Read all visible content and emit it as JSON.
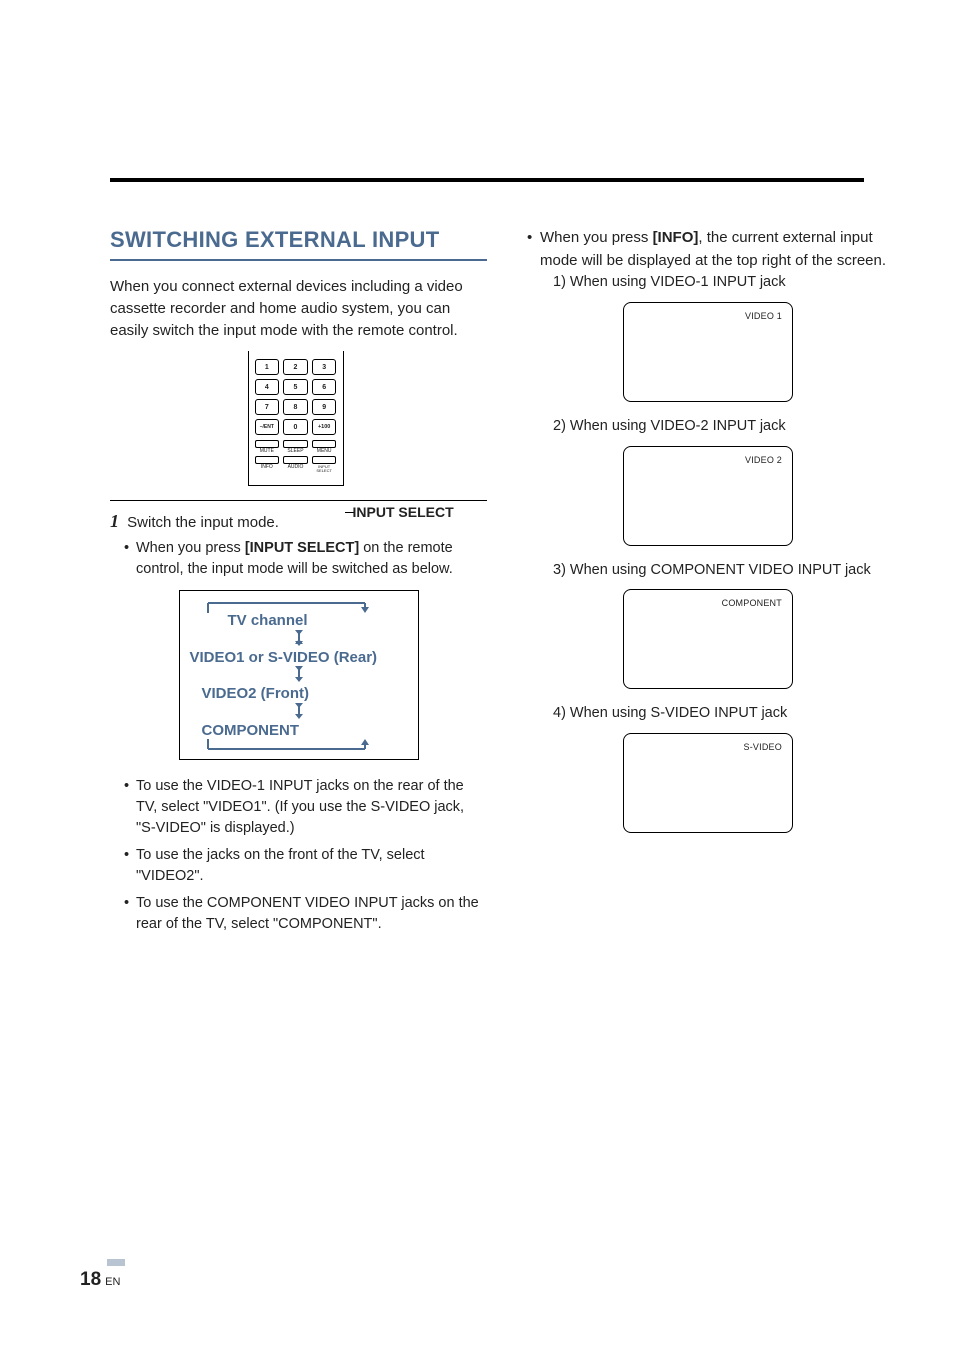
{
  "header": {
    "section_title": "SWITCHING EXTERNAL INPUT"
  },
  "intro": "When you connect external devices including a video cassette recorder and home audio system, you can easily switch the input mode with the remote control.",
  "remote": {
    "keys": [
      "1",
      "2",
      "3",
      "4",
      "5",
      "6",
      "7",
      "8",
      "9",
      "–/ENT",
      "0",
      "+100"
    ],
    "fn_row1": [
      "MUTE",
      "SLEEP",
      "MENU"
    ],
    "fn_row2": [
      "INFO",
      "AUDIO",
      "INPUT SELECT"
    ],
    "callout": "INPUT SELECT"
  },
  "step1": {
    "num": "1",
    "text": "Switch the input mode.",
    "bullet1_a": "When you press ",
    "bullet1_b": "[INPUT SELECT]",
    "bullet1_c": " on the remote control, the input mode will be switched as below.",
    "diagram": {
      "line1": "TV channel",
      "line2": "VIDEO1 or S-VIDEO (Rear)",
      "line3": "VIDEO2 (Front)",
      "line4": "COMPONENT"
    },
    "bullet2": "To use the VIDEO-1 INPUT jacks on the rear of the TV, select \"VIDEO1\". (If you use the S-VIDEO jack, \"S-VIDEO\" is displayed.)",
    "bullet3": "To use the jacks on the front of the TV, select \"VIDEO2\".",
    "bullet4": "To use the COMPONENT VIDEO INPUT jacks on the rear of the TV, select \"COMPONENT\"."
  },
  "right": {
    "bullet_a": "When you press ",
    "bullet_b": "[INFO]",
    "bullet_c": ", the current external input mode will be displayed at the top right of the screen.",
    "item1": "1) When using VIDEO-1 INPUT jack",
    "tv1": "VIDEO 1",
    "item2": "2) When using VIDEO-2 INPUT jack",
    "tv2": "VIDEO 2",
    "item3": "3) When using COMPONENT VIDEO INPUT jack",
    "tv3": "COMPONENT",
    "item4": "4) When using S-VIDEO INPUT jack",
    "tv4": "S-VIDEO"
  },
  "footer": {
    "page_num": "18",
    "lang": "EN"
  }
}
